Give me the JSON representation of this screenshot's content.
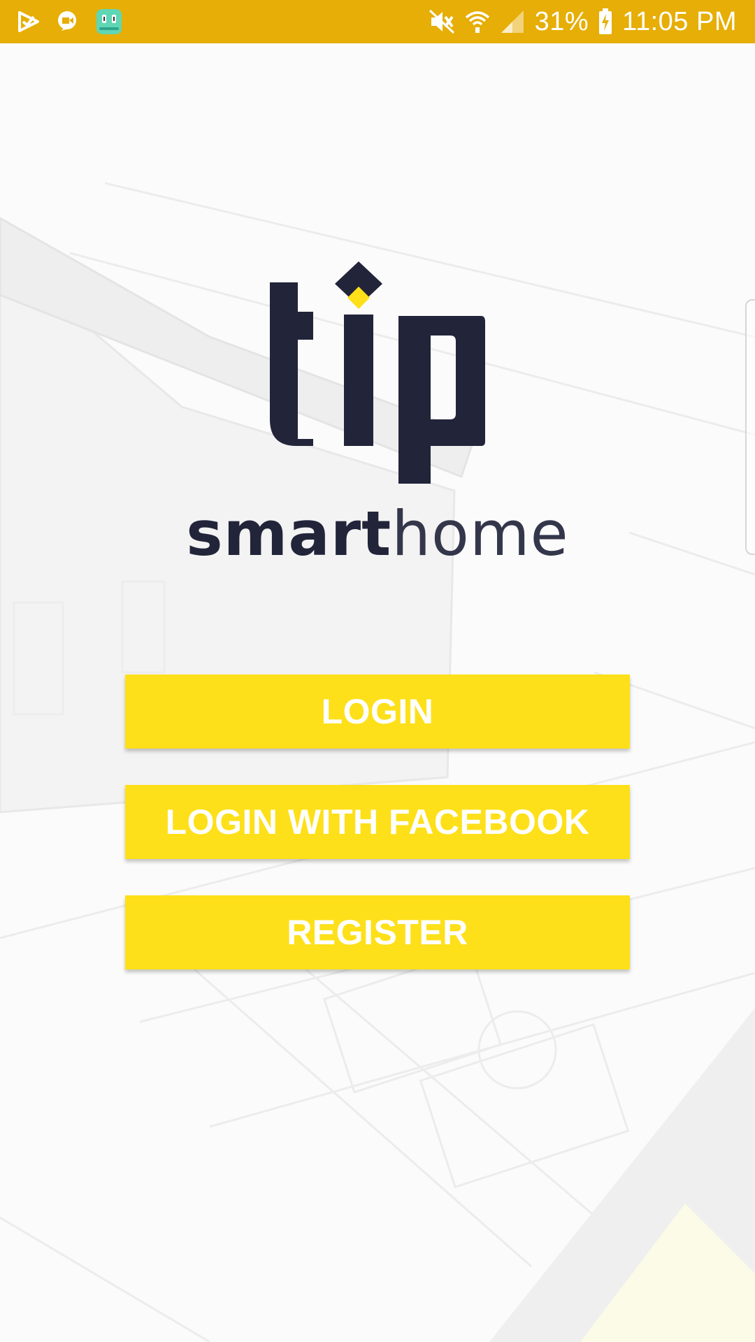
{
  "status_bar": {
    "battery": "31%",
    "time": "11:05 PM",
    "left_icons": [
      "play-store-icon",
      "duo-video-icon",
      "android-robot-icon"
    ],
    "right_icons": [
      "mute-icon",
      "wifi-icon",
      "signal-icon",
      "battery-charging-icon"
    ]
  },
  "logo": {
    "brand_bold": "smart",
    "brand_light": "home"
  },
  "buttons": {
    "login": "LOGIN",
    "facebook": "LOGIN WITH FACEBOOK",
    "register": "REGISTER"
  },
  "colors": {
    "status_bar": "#e6ae06",
    "button": "#fde019",
    "logo_navy": "#22243a"
  }
}
